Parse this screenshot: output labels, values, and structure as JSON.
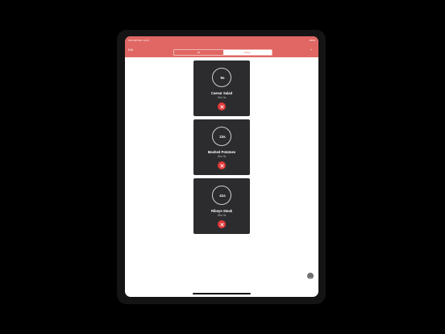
{
  "status_bar": {
    "left": "9:41 AM  Mon Jun 8",
    "center": "",
    "right": "100%"
  },
  "nav": {
    "left_label": "Edit",
    "right_icon": "plus-icon"
  },
  "segments": [
    {
      "label": "All"
    },
    {
      "label": "Active"
    }
  ],
  "timers": [
    {
      "countdown": "9s",
      "name": "Caesar Salad",
      "duration": "10m 0s"
    },
    {
      "countdown": "23s",
      "name": "Mashed Potatoes",
      "duration": "20m 0s"
    },
    {
      "countdown": "41s",
      "name": "Ribeye Steak",
      "duration": "25m 0s"
    }
  ],
  "colors": {
    "accent": "#e06763",
    "card": "#2c2c2e",
    "delete": "#e03a3a"
  }
}
